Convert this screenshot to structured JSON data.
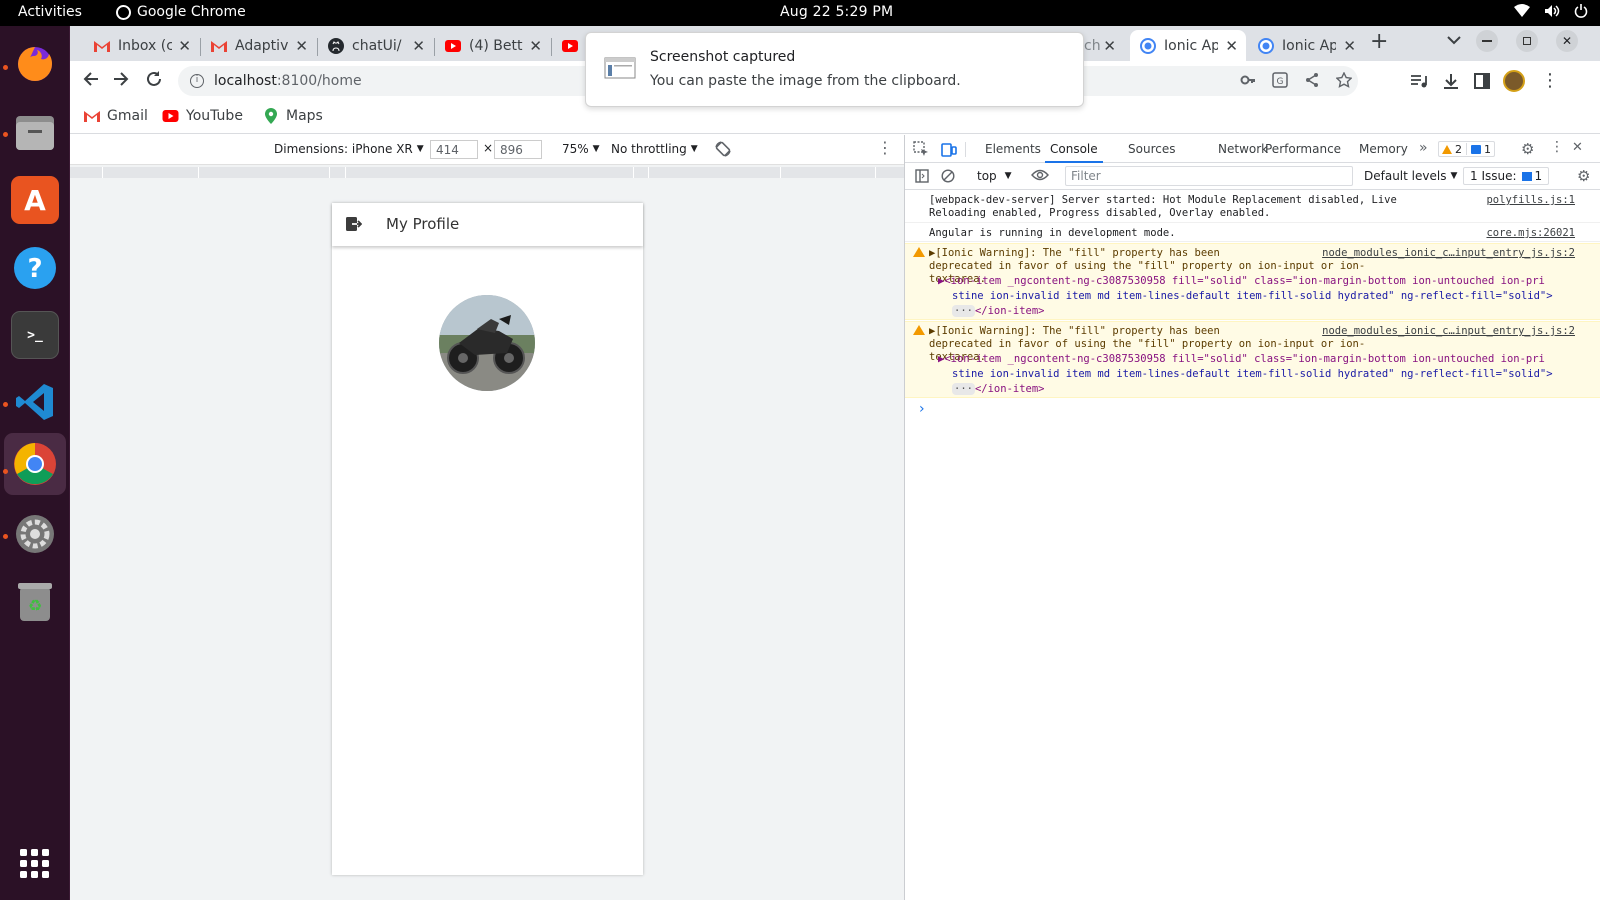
{
  "topbar": {
    "activities": "Activities",
    "app_name": "Google Chrome",
    "clock": "Aug 22  5:29 PM"
  },
  "tabs": [
    {
      "title": "Inbox (c",
      "icon": "gmail-icon"
    },
    {
      "title": "Adaptiv",
      "icon": "gmail-icon"
    },
    {
      "title": "chatUi/",
      "icon": "github-icon"
    },
    {
      "title": "(4) Bett",
      "icon": "youtube-icon"
    },
    {
      "title": "(",
      "icon": "youtube-icon"
    },
    {
      "title": "ch",
      "icon": ""
    },
    {
      "title": "Ionic Ap",
      "icon": "chrome-icon"
    },
    {
      "title": "Ionic Ap",
      "icon": "chrome-icon"
    }
  ],
  "omnibox": {
    "host": "localhost",
    "path": ":8100/home"
  },
  "bookmarks": [
    {
      "label": "Gmail",
      "icon": "gmail-icon"
    },
    {
      "label": "YouTube",
      "icon": "youtube-icon"
    },
    {
      "label": "Maps",
      "icon": "maps-icon"
    }
  ],
  "device": {
    "dimensions": "Dimensions: iPhone XR",
    "width": "414",
    "height": "896",
    "times": "×",
    "zoom": "75%",
    "throttle": "No throttling"
  },
  "app": {
    "header_title": "My Profile"
  },
  "devtools": {
    "tabs": [
      "Elements",
      "Console",
      "Sources",
      "Network",
      "Performance",
      "Memory"
    ],
    "active_tab": "Console",
    "warn_count": "2",
    "info_count": "1",
    "context": "top",
    "filter_placeholder": "Filter",
    "levels": "Default levels",
    "issues": "1 Issue:",
    "issues_count": "1",
    "logs": [
      {
        "msg": "[webpack-dev-server] Server started: Hot Module Replacement disabled, Live\nReloading enabled, Progress disabled, Overlay enabled.",
        "src": "polyfills.js:1"
      },
      {
        "msg": "Angular is running in development mode.",
        "src": "core.mjs:26021"
      },
      {
        "msg": "▶[Ionic Warning]: The \"fill\" property has been\ndeprecated in favor of using the \"fill\" property on ion-input or ion-textarea.",
        "src": "node_modules_ionic_c…input_entry_js.js:2",
        "detail_1": "ion-item _ngcontent-ng-c3087530958 fill=\"solid\" class=\"ion-margin-bottom ion-untouched ion-pri",
        "detail_2": "stine ion-invalid item md item-lines-default item-fill-solid hydrated\" ng-reflect-fill=\"solid\">",
        "detail_3": "</ion-item>"
      },
      {
        "msg": "▶[Ionic Warning]: The \"fill\" property has been\ndeprecated in favor of using the \"fill\" property on ion-input or ion-textarea.",
        "src": "node_modules_ionic_c…input_entry_js.js:2",
        "detail_1": "ion-item _ngcontent-ng-c3087530958 fill=\"solid\" class=\"ion-margin-bottom ion-untouched ion-pri",
        "detail_2": "stine ion-invalid item md item-lines-default item-fill-solid hydrated\" ng-reflect-fill=\"solid\">",
        "detail_3": "</ion-item>"
      }
    ],
    "prompt": "›"
  },
  "notification": {
    "title": "Screenshot captured",
    "body": "You can paste the image from the clipboard."
  }
}
